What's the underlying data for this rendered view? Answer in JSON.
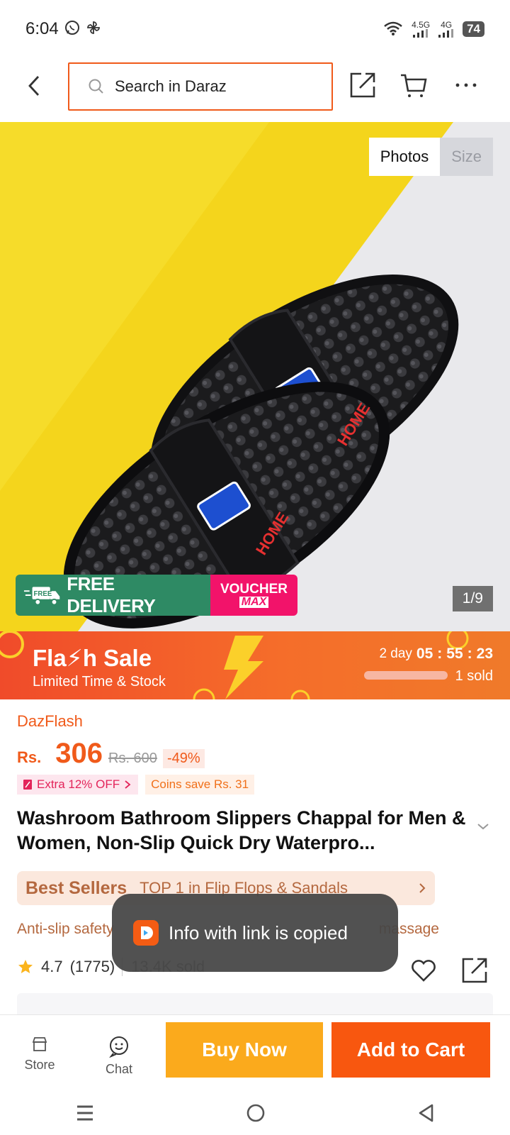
{
  "status_bar": {
    "time": "6:04",
    "network_1": "4.5G",
    "network_2": "4G",
    "battery": "74"
  },
  "search": {
    "placeholder": "Search in Daraz"
  },
  "media": {
    "tabs": [
      "Photos",
      "Size"
    ],
    "active_tab": "Photos",
    "counter": "1/9",
    "slipper_label": "HOME",
    "promo_free_delivery": "FREE DELIVERY",
    "promo_free_badge": "FREE",
    "promo_voucher": "VOUCHER",
    "promo_max": "MAX"
  },
  "flash_sale": {
    "title": "Fla⚡h Sale",
    "subtitle": "Limited Time & Stock",
    "days": "2 day",
    "hours": "05",
    "minutes": "55",
    "seconds": "23",
    "sold": "1 sold"
  },
  "product": {
    "brand": "DazFlash",
    "currency": "Rs.",
    "price": "306",
    "old_price": "Rs. 600",
    "discount": "-49%",
    "extra_off": "Extra 12% OFF",
    "coins_save": "Coins save Rs. 31",
    "title": "Washroom Bathroom Slippers Chappal for Men & Women, Non-Slip Quick Dry Waterpro...",
    "best_seller_label": "Best Sellers",
    "best_seller_text": "TOP 1 in Flip Flops & Sandals",
    "feature_1": "Anti-slip safety",
    "feature_2": "massage",
    "rating": "4.7",
    "rating_count": "(1775)",
    "sold": "13.4K sold"
  },
  "toast": {
    "message": "Info with link is copied"
  },
  "bottom_bar": {
    "store": "Store",
    "chat": "Chat",
    "buy_now": "Buy Now",
    "add_to_cart": "Add to Cart"
  },
  "colors": {
    "accent": "#f05a1a",
    "buy_now": "#fbaa1c",
    "add_to_cart": "#f8570f",
    "free_delivery": "#2e8a64",
    "voucher": "#f2136a"
  }
}
